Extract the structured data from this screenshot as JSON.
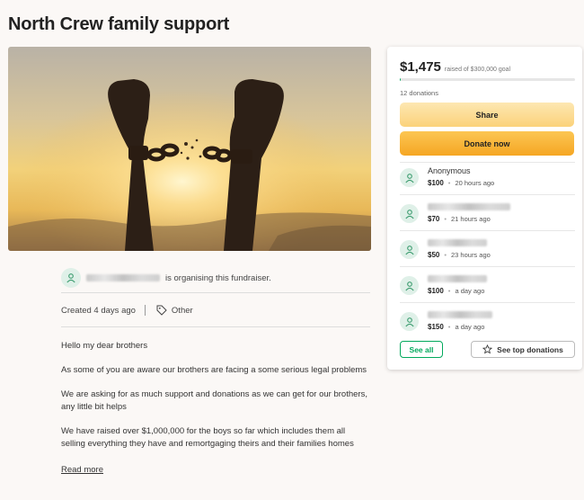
{
  "page": {
    "title": "North Crew family support"
  },
  "organiser": {
    "text": "is organising this fundraiser."
  },
  "meta": {
    "created": "Created 4 days ago",
    "category": "Other"
  },
  "story": {
    "paragraphs": [
      "Hello my dear brothers",
      "As some of you are aware our brothers are facing a some serious legal problems",
      "We are asking for as much support and donations as we can get for our brothers, any little bit helps",
      "We have raised over $1,000,000 for the boys so far which includes them all selling everything they have and remortgaging theirs and their families homes"
    ],
    "read_more": "Read more"
  },
  "card": {
    "amount": "$1,475",
    "goal_text": "raised of $300,000 goal",
    "progress_fraction": 0.005,
    "donations_count": "12 donations",
    "share_label": "Share",
    "donate_label": "Donate now",
    "see_all_label": "See all",
    "see_top_label": "See top donations",
    "accent_color": "#02a95c"
  },
  "donors": [
    {
      "name": "Anonymous",
      "amount": "$100",
      "time": "20 hours ago"
    },
    {
      "name": "",
      "amount": "$70",
      "time": "21 hours ago"
    },
    {
      "name": "",
      "amount": "$50",
      "time": "23 hours ago"
    },
    {
      "name": "",
      "amount": "$100",
      "time": "a day ago"
    },
    {
      "name": "",
      "amount": "$150",
      "time": "a day ago"
    }
  ]
}
